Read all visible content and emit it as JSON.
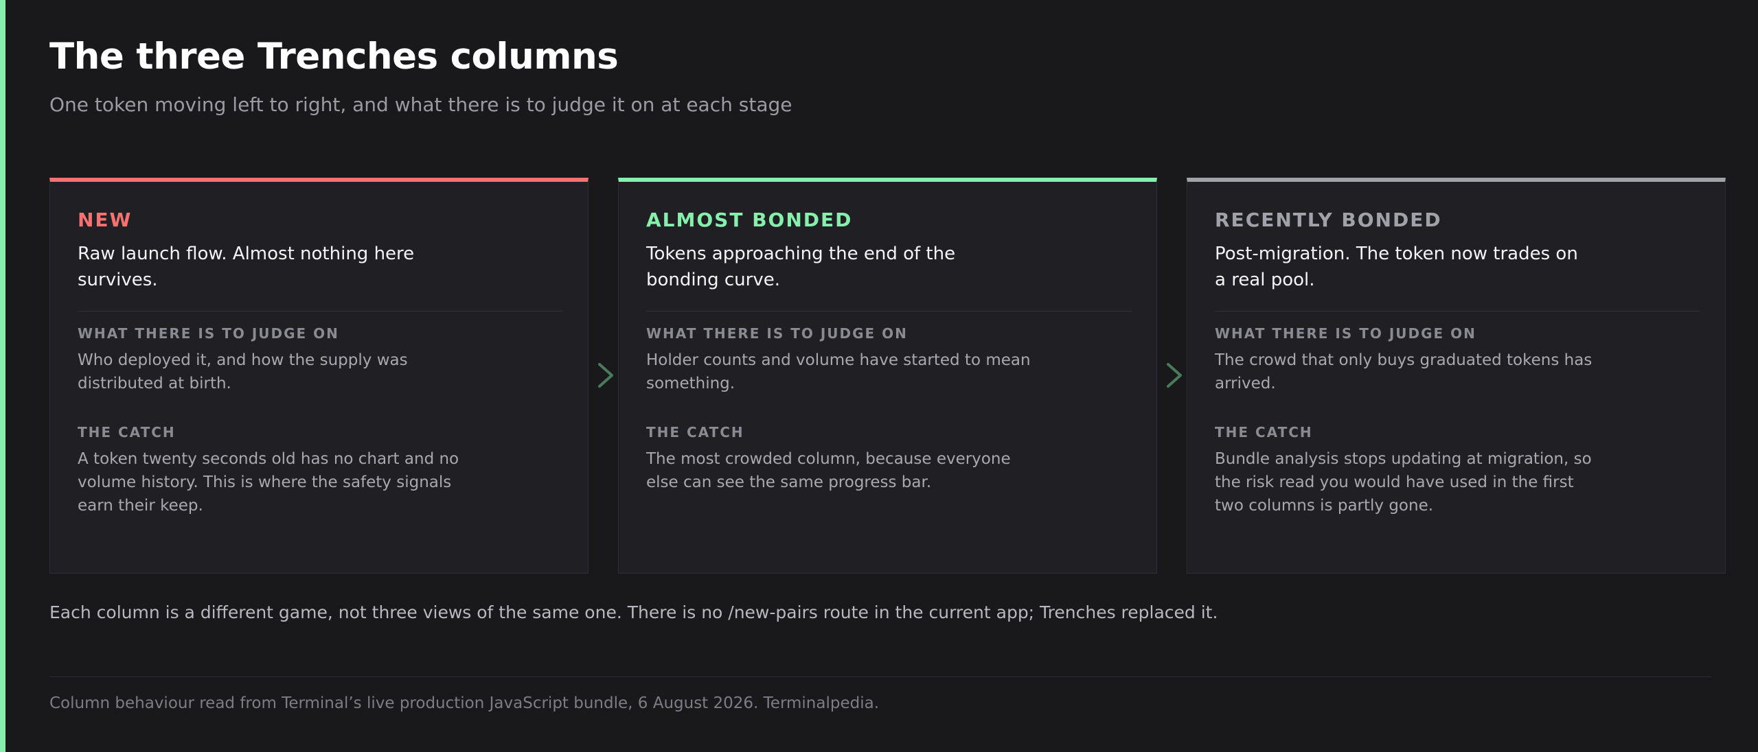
{
  "header": {
    "title": "The three Trenches columns",
    "subtitle": "One token moving left to right, and what there is to judge it on at each stage"
  },
  "colors": {
    "accent_bar": "#86efac",
    "new": "#f87171",
    "almost_bonded": "#86efac",
    "recently_bonded": "#a1a1aa",
    "arrow": "#4a7a5c"
  },
  "columns": [
    {
      "label": "NEW",
      "description": "Raw launch flow. Almost nothing here survives.",
      "judge_label": "WHAT THERE IS TO JUDGE ON",
      "judge_text": "Who deployed it, and how the supply was distributed at birth.",
      "catch_label": "THE CATCH",
      "catch_text": "A token twenty seconds old has no chart and no volume history. This is where the safety signals earn their keep."
    },
    {
      "label": "ALMOST BONDED",
      "description": "Tokens approaching the end of the bonding curve.",
      "judge_label": "WHAT THERE IS TO JUDGE ON",
      "judge_text": "Holder counts and volume have started to mean something.",
      "catch_label": "THE CATCH",
      "catch_text": "The most crowded column, because everyone else can see the same progress bar."
    },
    {
      "label": "RECENTLY BONDED",
      "description": "Post-migration. The token now trades on a real pool.",
      "judge_label": "WHAT THERE IS TO JUDGE ON",
      "judge_text": "The crowd that only buys graduated tokens has arrived.",
      "catch_label": "THE CATCH",
      "catch_text": "Bundle analysis stops updating at migration, so the risk read you would have used in the first two columns is partly gone."
    }
  ],
  "note": "Each column is a different game, not three views of the same one. There is no /new-pairs route in the current app; Trenches replaced it.",
  "footer": "Column behaviour read from Terminal’s live production JavaScript bundle, 6 August 2026. Terminalpedia.",
  "icons": {
    "arrow": "chevron-right-icon"
  }
}
